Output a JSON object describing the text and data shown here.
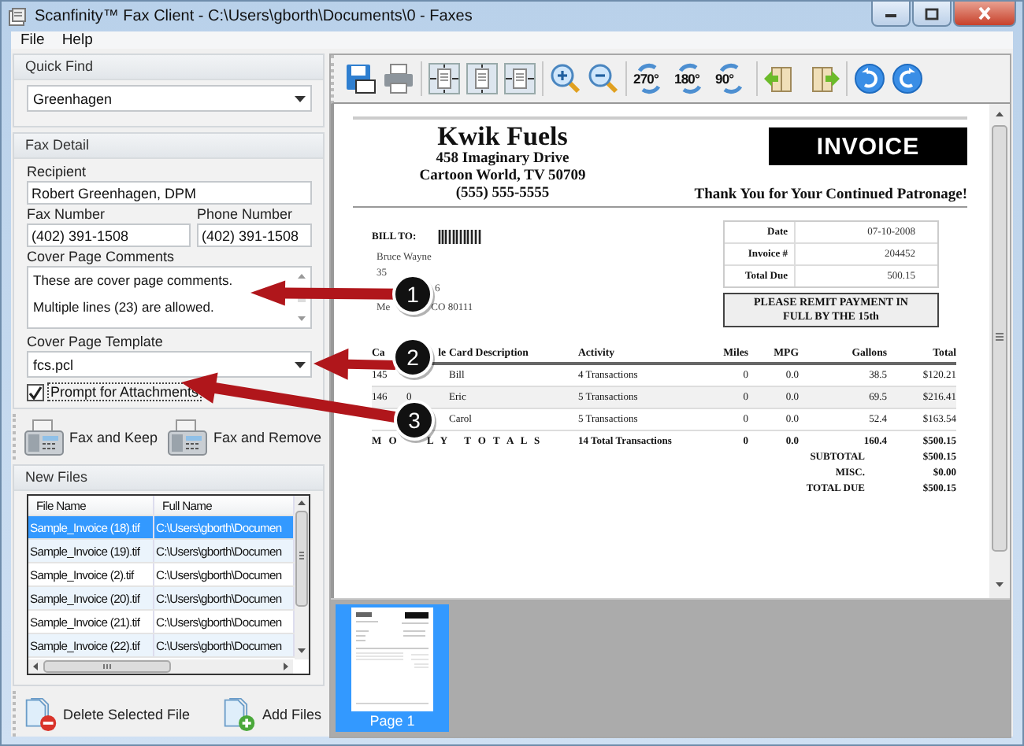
{
  "window": {
    "title": "Scanfinity™ Fax Client - C:\\Users\\gborth\\Documents\\0 - Faxes"
  },
  "menu": [
    "File",
    "Help"
  ],
  "quick_find": {
    "heading": "Quick Find",
    "value": "Greenhagen"
  },
  "fax_detail": {
    "heading": "Fax Detail",
    "recipient_label": "Recipient",
    "recipient": "Robert Greenhagen, DPM",
    "fax_label": "Fax Number",
    "fax": "(402) 391-1508",
    "phone_label": "Phone Number",
    "phone": "(402) 391-1508",
    "comments_label": "Cover Page Comments",
    "comments": [
      "These are cover page comments.",
      "Multiple lines (23) are allowed."
    ],
    "template_label": "Cover Page Template",
    "template": "fcs.pcl",
    "prompt": {
      "label": "Prompt for Attachments",
      "checked": true
    }
  },
  "actions": [
    {
      "label": "Fax and Keep"
    },
    {
      "label": "Fax and Remove"
    }
  ],
  "new_files": {
    "heading": "New Files",
    "columns": [
      "File Name",
      "Full Name"
    ],
    "rows": [
      {
        "file": "Sample_Invoice (18).tif",
        "path": "C:\\Users\\gborth\\Documen",
        "selected": true
      },
      {
        "file": "Sample_Invoice (19).tif",
        "path": "C:\\Users\\gborth\\Documen",
        "selected": false
      },
      {
        "file": "Sample_Invoice (2).tif",
        "path": "C:\\Users\\gborth\\Documen",
        "selected": false
      },
      {
        "file": "Sample_Invoice (20).tif",
        "path": "C:\\Users\\gborth\\Documen",
        "selected": false
      },
      {
        "file": "Sample_Invoice (21).tif",
        "path": "C:\\Users\\gborth\\Documen",
        "selected": false
      },
      {
        "file": "Sample_Invoice (22).tif",
        "path": "C:\\Users\\gborth\\Documen",
        "selected": false
      }
    ]
  },
  "bottom_actions": [
    {
      "kind": "delete",
      "label": "Delete Selected File"
    },
    {
      "kind": "add",
      "label": "Add Files"
    }
  ],
  "toolbar": [
    [
      {
        "kind": "save"
      },
      {
        "kind": "print"
      }
    ],
    [
      {
        "kind": "fit-page"
      },
      {
        "kind": "fit-height"
      },
      {
        "kind": "fit-width"
      }
    ],
    [
      {
        "kind": "zoom-in"
      },
      {
        "kind": "zoom-out"
      }
    ],
    [
      {
        "kind": "rotate",
        "label": "270°"
      },
      {
        "kind": "rotate",
        "label": "180°"
      },
      {
        "kind": "rotate",
        "label": "90°"
      }
    ],
    [
      {
        "kind": "prev-page"
      },
      {
        "kind": "next-page"
      }
    ],
    [
      {
        "kind": "undo"
      },
      {
        "kind": "redo"
      }
    ]
  ],
  "invoice": {
    "company": "Kwik Fuels",
    "address": [
      "458 Imaginary Drive",
      "Cartoon World, TV 50709",
      "(555) 555-5555"
    ],
    "badge": "INVOICE",
    "tagline": "Thank You for Your Continued Patronage!",
    "bill_to": "BILL TO:",
    "customer": [
      [
        "Bruce Wayne"
      ],
      [
        "35"
      ],
      [
        "6"
      ],
      [
        "Me",
        "CO 80111"
      ]
    ],
    "summary": [
      {
        "label": "Date",
        "value": "07-10-2008"
      },
      {
        "label": "Invoice #",
        "value": "204452"
      },
      {
        "label": "Total Due",
        "value": "500.15"
      }
    ],
    "notice": "PLEASE REMIT PAYMENT IN FULL BY THE 15th",
    "columns": [
      "Ca",
      "le",
      "Card Description",
      "Activity",
      "Miles",
      "MPG",
      "Gallons",
      "Total"
    ],
    "rows": [
      [
        "145",
        "",
        "Bill",
        "4 Transactions",
        "0",
        "0.0",
        "38.5",
        "$120.21"
      ],
      [
        "146",
        "0",
        "Eric",
        "5 Transactions",
        "0",
        "0.0",
        "69.5",
        "$216.41"
      ],
      [
        "",
        "",
        "Carol",
        "5 Transactions",
        "0",
        "0.0",
        "52.4",
        "$163.54"
      ]
    ],
    "totals": {
      "label_parts": [
        "M O",
        "L Y   T O T A L S"
      ],
      "activity": "14 Total Transactions",
      "miles": "0",
      "mpg": "0.0",
      "gallons": "160.4",
      "total": "$500.15"
    },
    "footer": [
      {
        "label": "SUBTOTAL",
        "value": "$500.15"
      },
      {
        "label": "MISC.",
        "value": "$0.00"
      },
      {
        "label": "TOTAL DUE",
        "value": "$500.15"
      }
    ]
  },
  "thumbnails": [
    {
      "label": "Page 1",
      "selected": true
    }
  ],
  "callouts": [
    {
      "number": "1"
    },
    {
      "number": "2"
    },
    {
      "number": "3"
    }
  ]
}
